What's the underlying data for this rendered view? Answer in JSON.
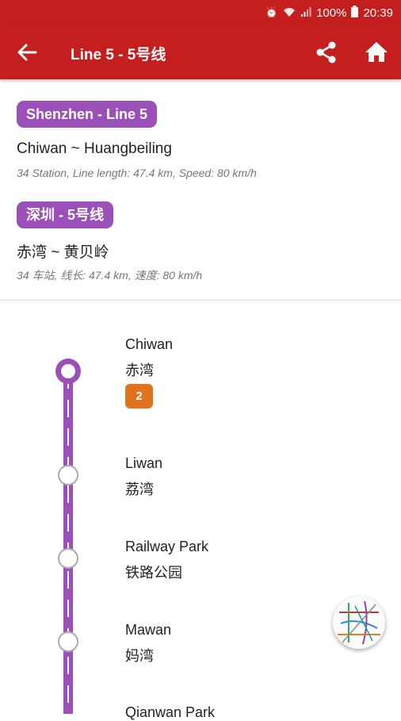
{
  "status_bar": {
    "battery": "100%",
    "time": "20:39"
  },
  "app_bar": {
    "title": "Line 5 - 5号线"
  },
  "line_info_en": {
    "badge": "Shenzhen - Line 5",
    "route": "Chiwan ~ Huangbeiling",
    "meta": "34 Station, Line length: 47.4 km, Speed: 80 km/h"
  },
  "line_info_cn": {
    "badge": "深圳 - 5号线",
    "route": "赤湾 ~ 黄贝岭",
    "meta": "34 车站, 线长: 47.4 km, 速度: 80 km/h"
  },
  "stations": [
    {
      "en": "Chiwan",
      "cn": "赤湾",
      "transfer": "2"
    },
    {
      "en": "Liwan",
      "cn": "荔湾"
    },
    {
      "en": "Railway Park",
      "cn": "铁路公园"
    },
    {
      "en": "Mawan",
      "cn": "妈湾"
    },
    {
      "en": "Qianwan Park",
      "cn": ""
    }
  ],
  "colors": {
    "app_bar": "#c51e1e",
    "line": "#9b4fb8",
    "transfer_badge": "#e0741c"
  },
  "icons": {
    "back": "arrow-left-icon",
    "share": "share-icon",
    "home": "home-icon",
    "map": "metro-map-icon"
  }
}
